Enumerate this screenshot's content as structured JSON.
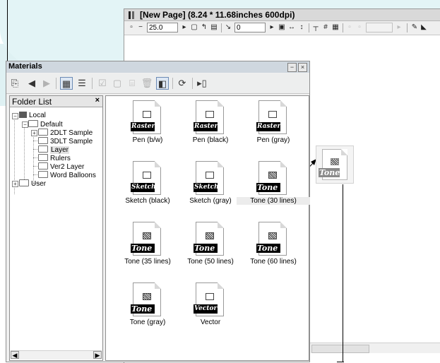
{
  "page_window": {
    "title": "[New Page] (8.24 * 11.68inches 600dpi)",
    "zoom": "25.0",
    "angle": "0"
  },
  "materials_window": {
    "title": "Materials",
    "folder_list": {
      "header": "Folder List",
      "close_glyph": "×",
      "tree": [
        {
          "label": "Local",
          "depth": 0,
          "icon": "computer-icon",
          "expander": "−"
        },
        {
          "label": "Default",
          "depth": 1,
          "icon": "folder-icon",
          "expander": "−"
        },
        {
          "label": "2DLT Sample",
          "depth": 2,
          "icon": "folder-icon",
          "expander": "+"
        },
        {
          "label": "3DLT Sample",
          "depth": 2,
          "icon": "folder-icon",
          "expander": ""
        },
        {
          "label": "Layer",
          "depth": 2,
          "icon": "folder-icon",
          "expander": "",
          "selected": true
        },
        {
          "label": "Rulers",
          "depth": 2,
          "icon": "folder-icon",
          "expander": ""
        },
        {
          "label": "Ver2 Layer",
          "depth": 2,
          "icon": "folder-icon",
          "expander": ""
        },
        {
          "label": "Word Balloons",
          "depth": 2,
          "icon": "folder-icon",
          "expander": ""
        },
        {
          "label": "User",
          "depth": 0,
          "icon": "folder-icon",
          "expander": "+"
        }
      ]
    },
    "items": [
      {
        "label": "Pen (b/w)",
        "badge": "Raster",
        "glyph": "plain"
      },
      {
        "label": "Pen (black)",
        "badge": "Raster",
        "glyph": "plain"
      },
      {
        "label": "Pen (gray)",
        "badge": "Raster",
        "glyph": "plain"
      },
      {
        "label": "Sketch (black)",
        "badge": "Sketch",
        "glyph": "plain"
      },
      {
        "label": "Sketch (gray)",
        "badge": "Sketch",
        "glyph": "plain"
      },
      {
        "label": "Tone (30 lines)",
        "badge": "Tone",
        "glyph": "tone",
        "selected": true
      },
      {
        "label": "Tone (35 lines)",
        "badge": "Tone",
        "glyph": "tone"
      },
      {
        "label": "Tone (50 lines)",
        "badge": "Tone",
        "glyph": "tone"
      },
      {
        "label": "Tone (60 lines)",
        "badge": "Tone",
        "glyph": "tone"
      },
      {
        "label": "Tone (gray)",
        "badge": "Tone",
        "glyph": "tone"
      },
      {
        "label": "Vector",
        "badge": "Vector",
        "glyph": "vector"
      }
    ]
  },
  "drag_ghost": {
    "badge": "Tone"
  },
  "colors": {
    "band": "#e3f4f6",
    "window_bg": "#f0f0f0",
    "title_bar": "#cfd7df"
  }
}
